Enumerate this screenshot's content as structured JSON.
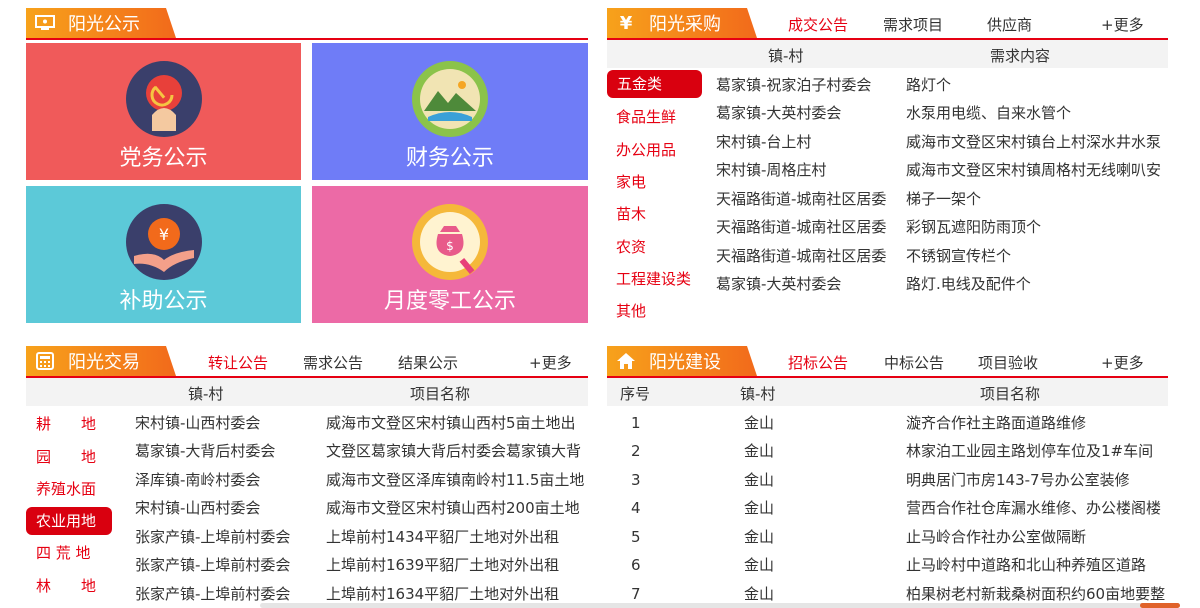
{
  "gongshi": {
    "title": "阳光公示",
    "tiles": [
      {
        "label": "党务公示",
        "color": "#f05a5a"
      },
      {
        "label": "财务公示",
        "color": "#6f7cf7"
      },
      {
        "label": "补助公示",
        "color": "#5cc9d8"
      },
      {
        "label": "月度零工公示",
        "color": "#ec6aa6"
      }
    ]
  },
  "caigou": {
    "title": "阳光采购",
    "tabs": [
      "成交公告",
      "需求项目",
      "供应商"
    ],
    "more": "+更多",
    "headers": [
      "镇-村",
      "需求内容"
    ],
    "categories": [
      "五金类",
      "食品生鲜",
      "办公用品",
      "家电",
      "苗木",
      "农资",
      "工程建设类",
      "其他"
    ],
    "rows": [
      [
        "葛家镇-祝家泊子村委会",
        "路灯个"
      ],
      [
        "葛家镇-大英村委会",
        "水泵用电缆、自来水管个"
      ],
      [
        "宋村镇-台上村",
        "威海市文登区宋村镇台上村深水井水泵"
      ],
      [
        "宋村镇-周格庄村",
        "威海市文登区宋村镇周格村无线喇叭安"
      ],
      [
        "天福路街道-城南社区居委",
        "梯子一架个"
      ],
      [
        "天福路街道-城南社区居委",
        "彩钢瓦遮阳防雨顶个"
      ],
      [
        "天福路街道-城南社区居委",
        "不锈钢宣传栏个"
      ],
      [
        "葛家镇-大英村委会",
        "路灯.电线及配件个"
      ]
    ]
  },
  "jiaoyi": {
    "title": "阳光交易",
    "tabs": [
      "转让公告",
      "需求公告",
      "结果公示"
    ],
    "more": "+更多",
    "headers": [
      "镇-村",
      "项目名称"
    ],
    "categories": [
      "耕　　地",
      "园　　地",
      "养殖水面",
      "农业用地",
      "四 荒 地",
      "林　　地"
    ],
    "rows": [
      [
        "宋村镇-山西村委会",
        "威海市文登区宋村镇山西村5亩土地出"
      ],
      [
        "葛家镇-大背后村委会",
        "文登区葛家镇大背后村委会葛家镇大背"
      ],
      [
        "泽库镇-南岭村委会",
        "威海市文登区泽库镇南岭村11.5亩土地"
      ],
      [
        "宋村镇-山西村委会",
        "威海市文登区宋村镇山西村200亩土地"
      ],
      [
        "张家产镇-上埠前村委会",
        "上埠前村1434平貂厂土地对外出租"
      ],
      [
        "张家产镇-上埠前村委会",
        "上埠前村1639平貂厂土地对外出租"
      ],
      [
        "张家产镇-上埠前村委会",
        "上埠前村1634平貂厂土地对外出租"
      ]
    ]
  },
  "jianshe": {
    "title": "阳光建设",
    "tabs": [
      "招标公告",
      "中标公告",
      "项目验收"
    ],
    "more": "+更多",
    "headers": [
      "序号",
      "镇-村",
      "项目名称"
    ],
    "rows": [
      [
        "1",
        "金山",
        "漩齐合作社主路面道路维修"
      ],
      [
        "2",
        "金山",
        "林家泊工业园主路划停车位及1#车间"
      ],
      [
        "3",
        "金山",
        "明典居门市房143-7号办公室装修"
      ],
      [
        "4",
        "金山",
        "营西合作社仓库漏水维修、办公楼阁楼"
      ],
      [
        "5",
        "金山",
        "止马岭合作社办公室做隔断"
      ],
      [
        "6",
        "金山",
        "止马岭村中道路和北山种养殖区道路"
      ],
      [
        "7",
        "金山",
        "柏果树老村新栽桑树面积约60亩地要整"
      ]
    ]
  },
  "colors": {
    "accent": "#e60012",
    "header_orange": "#f26a1b"
  }
}
